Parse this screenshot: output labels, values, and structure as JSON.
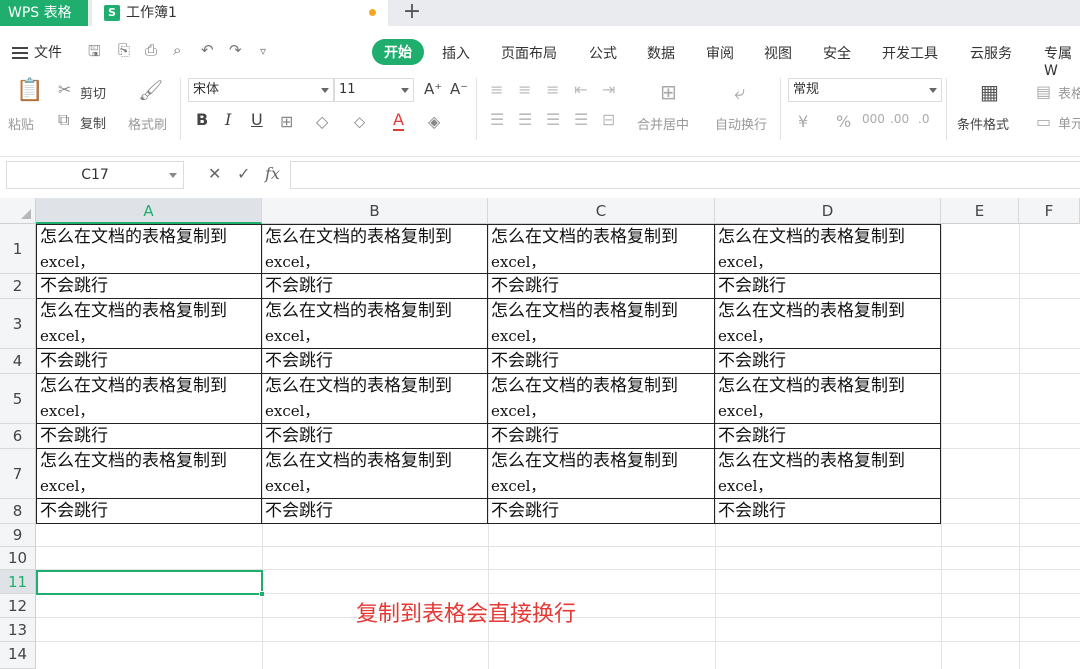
{
  "titlebar": {
    "app_tab": "WPS 表格",
    "doc_icon": "S",
    "doc_name": "工作簿1",
    "new_tab": "+"
  },
  "menubar": {
    "file": "文件",
    "tabs": [
      "开始",
      "插入",
      "页面布局",
      "公式",
      "数据",
      "审阅",
      "视图",
      "安全",
      "开发工具",
      "云服务",
      "专属W"
    ],
    "active_tab": "开始"
  },
  "ribbon": {
    "paste": "粘贴",
    "cut": "剪切",
    "copy": "复制",
    "format_painter": "格式刷",
    "font_name": "宋体",
    "font_size": "11",
    "bold": "B",
    "italic": "I",
    "underline": "U",
    "merge_center": "合并居中",
    "auto_wrap": "自动换行",
    "number_format": "常规",
    "conditional_format": "条件格式",
    "table_style": "表格",
    "cell": "单元"
  },
  "formulabar": {
    "cell_ref": "C17",
    "cancel": "✕",
    "confirm": "✓",
    "fx": "fx",
    "value": ""
  },
  "grid": {
    "columns": [
      "A",
      "B",
      "C",
      "D",
      "E",
      "F"
    ],
    "selected_column": "A",
    "rows": [
      "1",
      "2",
      "3",
      "4",
      "5",
      "6",
      "7",
      "8",
      "9",
      "10",
      "11",
      "12",
      "13",
      "14"
    ],
    "selected_row": "11",
    "text_long_line1": "怎么在文档的表格复制到",
    "text_long_line2": "excel，",
    "text_short": "不会跳行"
  },
  "annotation": "复制到表格会直接换行",
  "colors": {
    "accent": "#1fae6e",
    "note": "#e53935"
  }
}
